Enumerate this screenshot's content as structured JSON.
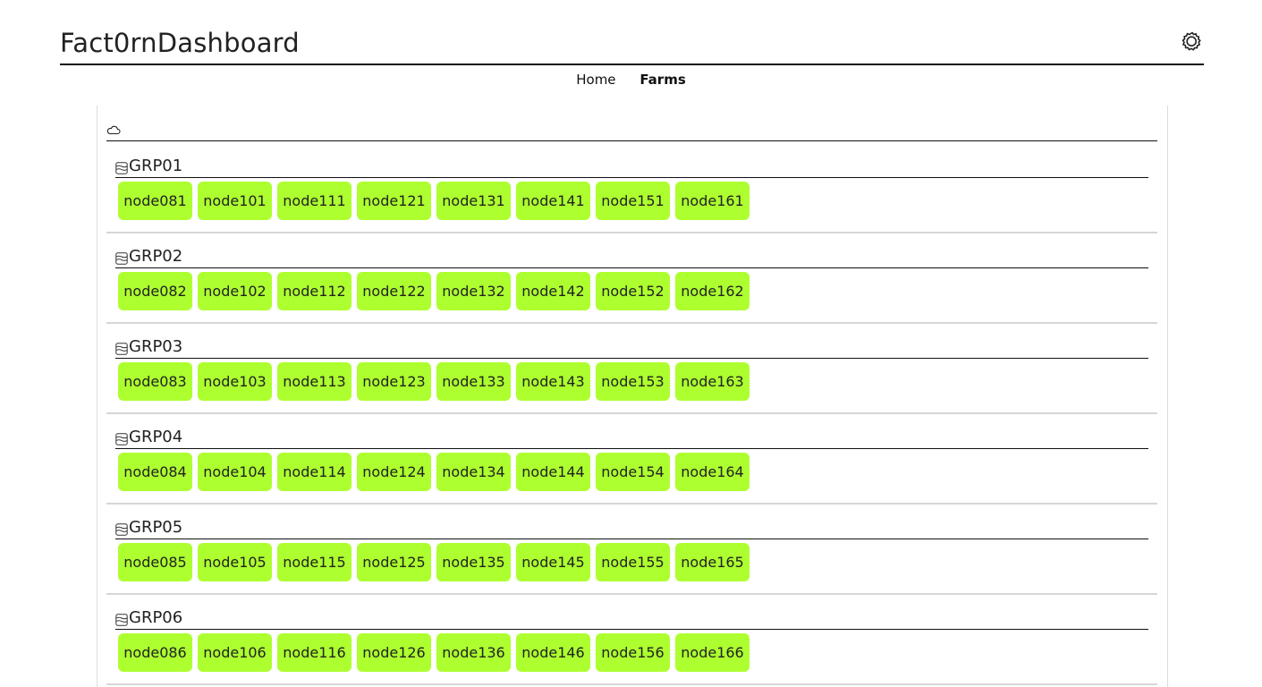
{
  "app": {
    "title": "Fact0rnDashboard"
  },
  "header": {
    "settings_icon": "gear-icon"
  },
  "nav": {
    "items": [
      {
        "label": "Home",
        "active": false
      },
      {
        "label": "Farms",
        "active": true
      }
    ]
  },
  "farm": {
    "icon": "cloud-icon"
  },
  "theme": {
    "node_color": "#adff2f",
    "node_status": "online"
  },
  "groups": [
    {
      "name": "GRP01",
      "icon": "server-stack-icon",
      "nodes": [
        "node081",
        "node101",
        "node111",
        "node121",
        "node131",
        "node141",
        "node151",
        "node161"
      ]
    },
    {
      "name": "GRP02",
      "icon": "server-stack-icon",
      "nodes": [
        "node082",
        "node102",
        "node112",
        "node122",
        "node132",
        "node142",
        "node152",
        "node162"
      ]
    },
    {
      "name": "GRP03",
      "icon": "server-stack-icon",
      "nodes": [
        "node083",
        "node103",
        "node113",
        "node123",
        "node133",
        "node143",
        "node153",
        "node163"
      ]
    },
    {
      "name": "GRP04",
      "icon": "server-stack-icon",
      "nodes": [
        "node084",
        "node104",
        "node114",
        "node124",
        "node134",
        "node144",
        "node154",
        "node164"
      ]
    },
    {
      "name": "GRP05",
      "icon": "server-stack-icon",
      "nodes": [
        "node085",
        "node105",
        "node115",
        "node125",
        "node135",
        "node145",
        "node155",
        "node165"
      ]
    },
    {
      "name": "GRP06",
      "icon": "server-stack-icon",
      "nodes": [
        "node086",
        "node106",
        "node116",
        "node126",
        "node136",
        "node146",
        "node156",
        "node166"
      ]
    }
  ]
}
